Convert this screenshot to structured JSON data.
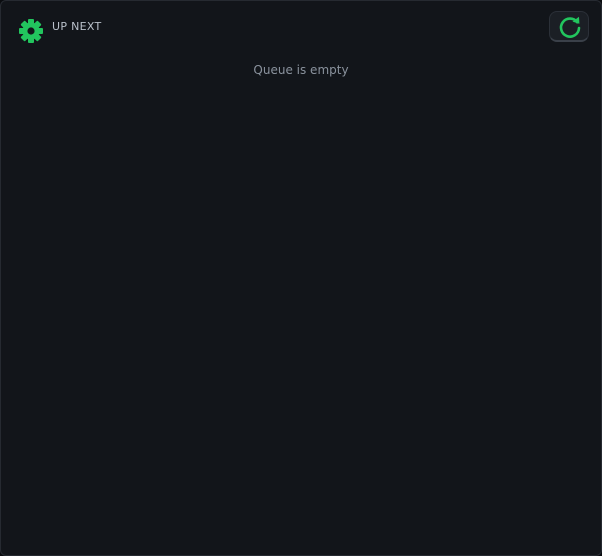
{
  "header": {
    "title": "UP NEXT",
    "settings_icon": "gear-icon",
    "refresh_icon": "refresh-icon"
  },
  "queue": {
    "empty_message": "Queue is empty"
  },
  "colors": {
    "accent": "#22c55e",
    "background": "#12151a",
    "text_muted": "#8a929d"
  }
}
